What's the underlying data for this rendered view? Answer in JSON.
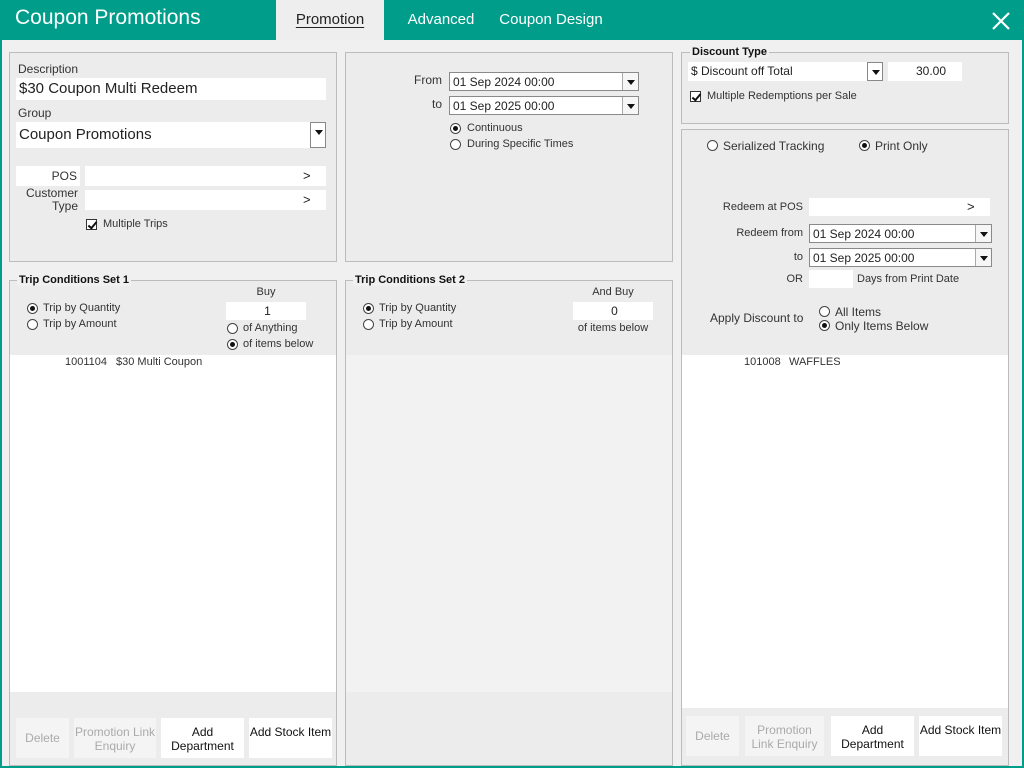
{
  "window": {
    "title": "Coupon Promotions"
  },
  "tabs": [
    {
      "label": "Promotion"
    },
    {
      "label": "Advanced"
    },
    {
      "label": "Coupon Design"
    }
  ],
  "general": {
    "description_label": "Description",
    "description_value": "$30 Coupon Multi Redeem",
    "group_label": "Group",
    "group_value": "Coupon Promotions",
    "pos_label": "POS",
    "customer_type_label": "Customer Type",
    "arrow": ">",
    "multiple_trips_label": "Multiple Trips",
    "multiple_trips_checked": true
  },
  "dates": {
    "from_label": "From",
    "from_value": "01 Sep  2024 00:00",
    "to_label": "to",
    "to_value": "01 Sep  2025 00:00",
    "continuous_label": "Continuous",
    "specific_label": "During Specific Times",
    "selected": "continuous"
  },
  "discount": {
    "title": "Discount Type",
    "type_value": "$ Discount off Total",
    "amount": "30.00",
    "multiple_redemptions_label": "Multiple Redemptions per Sale",
    "multiple_redemptions_checked": true
  },
  "tracking": {
    "serialized_label": "Serialized Tracking",
    "print_only_label": "Print Only",
    "selected": "print_only",
    "redeem_pos_label": "Redeem at POS",
    "redeem_from_label": "Redeem from",
    "redeem_from_value": "01 Sep  2024 00:00",
    "to_label": "to",
    "redeem_to_value": "01 Sep  2025 00:00",
    "or_label": "OR",
    "days_label": "Days from Print Date",
    "days_value": "",
    "apply_label": "Apply Discount to",
    "all_items_label": "All Items",
    "only_items_label": "Only Items Below",
    "apply_selected": "only_items",
    "items": [
      {
        "code": "101008",
        "name": "WAFFLES"
      }
    ]
  },
  "trip1": {
    "title": "Trip Conditions Set 1",
    "quantity_label": "Trip by Quantity",
    "amount_label": "Trip by Amount",
    "selected": "quantity",
    "buy_label": "Buy",
    "buy_value": "1",
    "anything_label": "of Anything",
    "items_below_label": "of items below",
    "buy_selected": "items_below",
    "items": [
      {
        "code": "1001104",
        "name": "$30 Multi Coupon"
      }
    ]
  },
  "trip2": {
    "title": "Trip Conditions Set 2",
    "quantity_label": "Trip by Quantity",
    "amount_label": "Trip by Amount",
    "selected": "quantity",
    "and_buy_label": "And Buy",
    "and_buy_value": "0",
    "items_below_label": "of items below"
  },
  "buttons": {
    "delete": "Delete",
    "link_enquiry": "Promotion Link Enquiry",
    "add_department": "Add Department",
    "add_stock_item": "Add Stock Item"
  }
}
